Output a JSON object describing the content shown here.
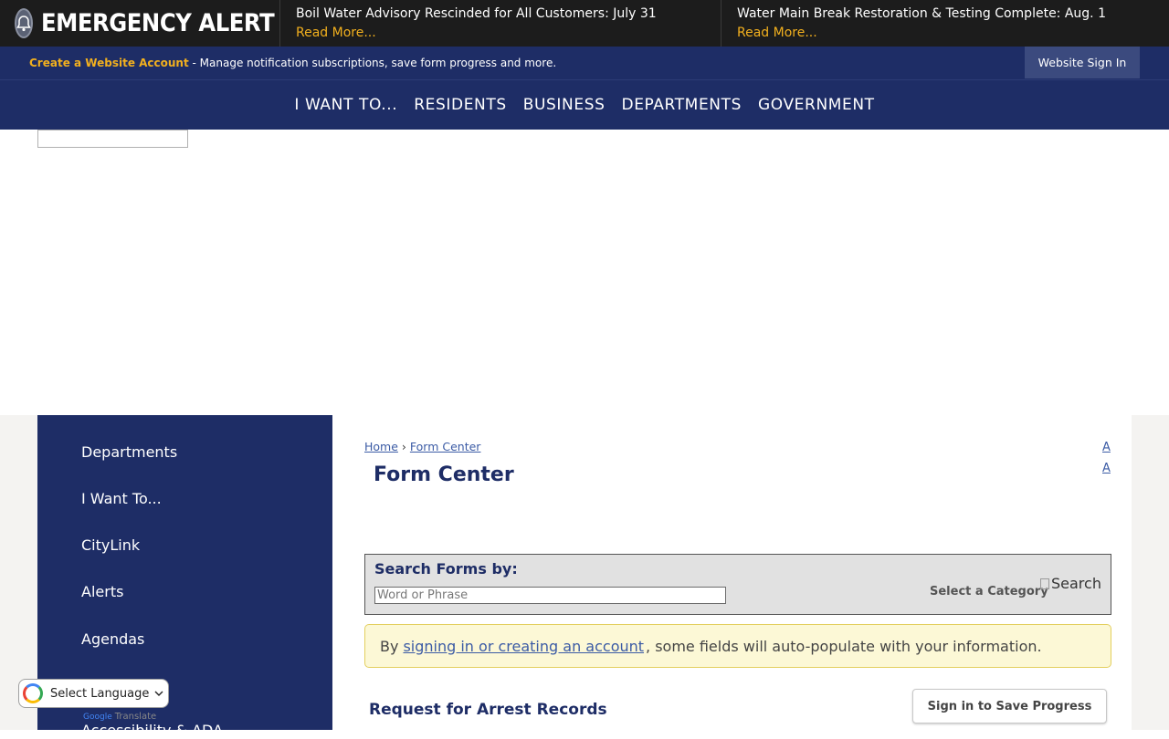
{
  "alert_bar": {
    "label": "EMERGENCY ALERT",
    "items": [
      {
        "text": "Boil Water Advisory Rescinded for All Customers: July 31",
        "link": "Read More..."
      },
      {
        "text": "Water Main Break Restoration & Testing Complete: Aug. 1",
        "link": "Read More..."
      }
    ]
  },
  "account_bar": {
    "create_link": "Create a Website Account",
    "description": " - Manage notification subscriptions, save form progress and more.",
    "signin_label": "Website Sign In"
  },
  "main_nav": {
    "items": [
      "I WANT TO...",
      "RESIDENTS",
      "BUSINESS",
      "DEPARTMENTS",
      "GOVERNMENT"
    ]
  },
  "sidebar": {
    "items": [
      "Departments",
      "I Want To...",
      "CityLink",
      "Alerts",
      "Agendas",
      "Accessibility & ADA"
    ]
  },
  "breadcrumb": {
    "home": "Home",
    "separator": "›",
    "current": "Form Center"
  },
  "page": {
    "title": "Form Center",
    "resize_labels": [
      "A",
      "A"
    ]
  },
  "search": {
    "label": "Search Forms by:",
    "placeholder": "Word or Phrase",
    "value": "",
    "category_label": "Select a Category",
    "button_alt": "Search"
  },
  "notice": {
    "prefix": "By",
    "link": "signing in or creating an account",
    "suffix": ", some fields will auto-populate with your information."
  },
  "form": {
    "title": "Request for Arrest Records",
    "save_button": "Sign in to Save Progress"
  },
  "translate": {
    "select_label": "Select Language",
    "powered_brand": "Google",
    "powered_text": "Translate"
  },
  "colors": {
    "navy": "#1e2d66",
    "alert_dark": "#1c1c1c",
    "gold": "#f2b01e",
    "link_blue": "#3b5ba5",
    "notice_bg": "#fcf8d6"
  }
}
